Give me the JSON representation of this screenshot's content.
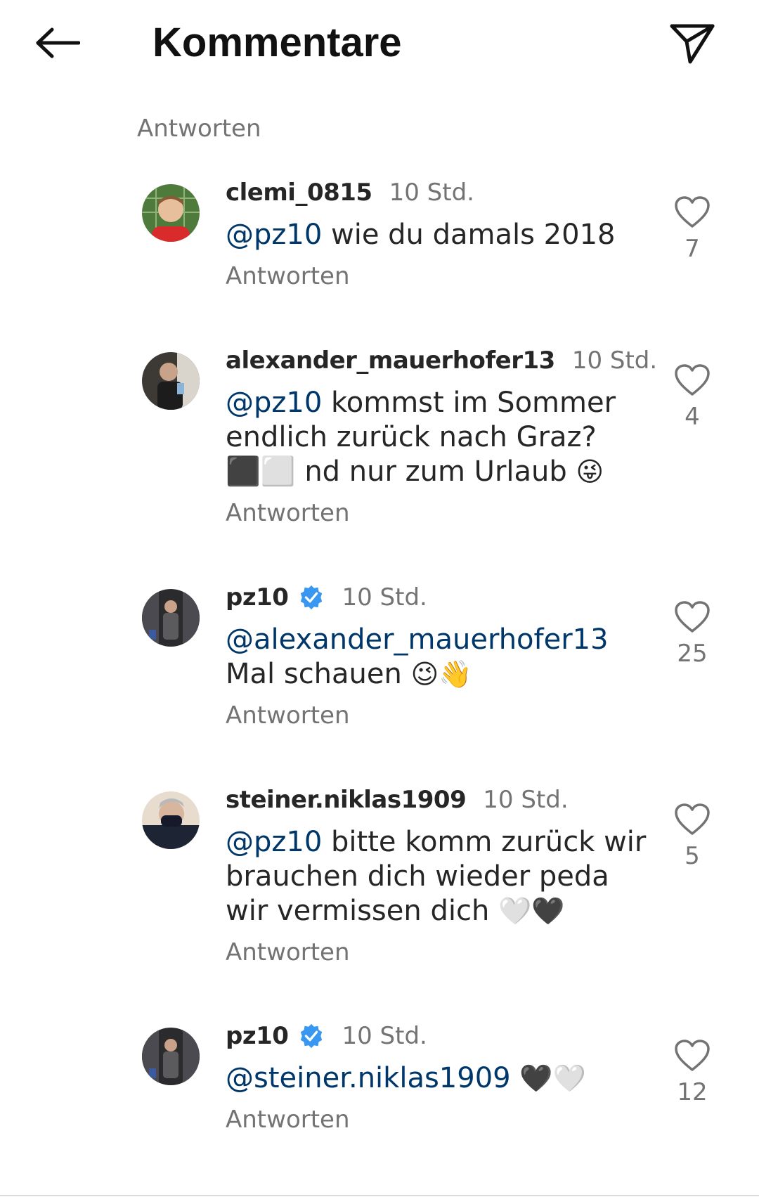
{
  "header": {
    "title": "Kommentare",
    "back_icon": "arrow-left-icon",
    "send_icon": "paper-plane-icon"
  },
  "top_reply_label": "Antworten",
  "reply_label": "Antworten",
  "colors": {
    "mention": "#00376b",
    "secondary_text": "#737373",
    "verified": "#3897f0"
  },
  "comments": [
    {
      "username": "clemi_0815",
      "verified": false,
      "time": "10 Std.",
      "mention": "@pz10",
      "text": " wie du damals 2018",
      "emoji": "",
      "likes": "7"
    },
    {
      "username": "alexander_mauerhofer13",
      "verified": false,
      "time": "10 Std.",
      "mention": "@pz10",
      "text": " kommst im Sommer endlich zurück nach Graz? ⬛⬜ nd nur zum Urlaub",
      "emoji": "😜",
      "likes": "4"
    },
    {
      "username": "pz10",
      "verified": true,
      "time": "10 Std.",
      "mention": "@alexander_mauerhofer13",
      "text": " Mal schauen",
      "emoji": "😉👋",
      "likes": "25"
    },
    {
      "username": "steiner.niklas1909",
      "verified": false,
      "time": "10 Std.",
      "mention": "@pz10",
      "text": " bitte komm zurück wir brauchen dich wieder peda wir vermissen dich",
      "emoji": "🤍🖤",
      "likes": "5"
    },
    {
      "username": "pz10",
      "verified": true,
      "time": "10 Std.",
      "mention": "@steiner.niklas1909",
      "text": " ",
      "emoji": "🖤🤍",
      "likes": "12"
    }
  ]
}
